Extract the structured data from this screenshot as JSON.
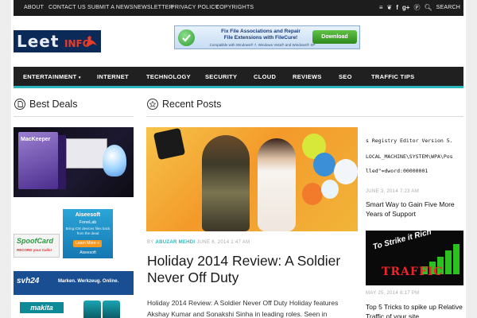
{
  "topbar": {
    "links": [
      "ABOUT",
      "CONTACT US",
      "SUBMIT A NEWS",
      "NEWSLETTER",
      "PRIVACY POLICY",
      "COPYRIGHTS"
    ],
    "search_label": "SEARCH"
  },
  "logo": {
    "word1": "Leet",
    "word2": "INFO"
  },
  "ad_banner": {
    "line1": "Fix File Associations and Repair",
    "line2": "File Extensions with FileCure!",
    "line3": "Compatible with Windows® 7, Windows Vista® and Windows® XP",
    "button": "Download"
  },
  "nav": {
    "items": [
      "ENTERTAINMENT",
      "INTERNET",
      "TECHNOLOGY",
      "SECURITY",
      "CLOUD",
      "REVIEWS",
      "SEO",
      "TRAFFIC TIPS"
    ]
  },
  "sidebar": {
    "title": "Best Deals",
    "mackeeper_label": "MacKeeper",
    "aiseesoft": {
      "brand": "Aiseesoft",
      "product": "FoneLab",
      "tagline": "Bring iOS devices files back from the dead",
      "button": "Learn More »",
      "footer": "Aiseesoft"
    },
    "spoofcard": {
      "name": "SpoofCard",
      "tagline": "RECORD your Calls!"
    },
    "svh": {
      "brand": "svh24",
      "slogan": "Marken. Werkzeug. Online."
    },
    "makita": {
      "brand": "makita"
    }
  },
  "main": {
    "title": "Recent Posts",
    "featured": {
      "by": "BY",
      "author": "ABUZAR MEHDI",
      "date": "JUNE 6, 2014 1:47 AM",
      "title": "Holiday 2014 Review: A Soldier Never Off Duty",
      "excerpt": "Holiday 2014 Review: A Soldier Never Off Duty Holiday features Akshay Kumar and Sonakshi Sinha in leading roles. Seen in supporting roles are"
    },
    "code_lines": [
      "s Registry Editor Version 5.",
      "LOCAL_MACHINE\\SYSTEM\\WPA\\Pos",
      "lled\"=dword:00000001"
    ],
    "side_posts": [
      {
        "date": "JUNE 3, 2014 7:23 AM",
        "title": "Smart Way to Gain Five More Years of Support"
      },
      {
        "date": "MAY 25, 2014 8:17 PM",
        "title": "Top 5 Tricks to spike up Relative Traffic of your site"
      }
    ],
    "traffic_caption": "To Strike it Rich",
    "traffic_big": "TRAFFIC"
  }
}
